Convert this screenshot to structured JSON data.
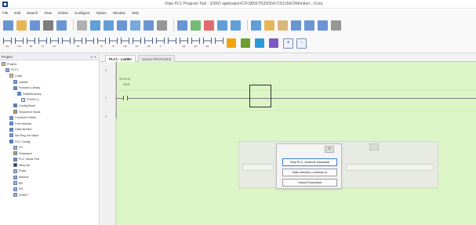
{
  "window": {
    "title": "Xinje PLC Program Tool - 3/3KD application\\C\\FSB5670\\3\\5\\5\\6\\7\\3\\1\\3\\ED\\Monitor\\...\\Corp"
  },
  "menu": [
    "File",
    "Edit",
    "Search",
    "View",
    "Online",
    "Configure",
    "Option",
    "Window",
    "Help"
  ],
  "toolbar_row1": {
    "icons": [
      "new-icon",
      "open-icon",
      "save-icon",
      "cut-icon",
      "copy-icon",
      "paste-icon",
      "undo-icon",
      "redo-icon",
      "find-icon",
      "block-icon",
      "list-icon",
      "print-icon",
      "settings-icon",
      "run-icon",
      "stop-icon",
      "monitor-icon",
      "upload-icon",
      "download-icon",
      "folder-icon",
      "user-icon",
      "image-icon",
      "chart-icon",
      "table-icon",
      "minus-icon"
    ]
  },
  "toolbar_row2": {
    "items": [
      {
        "icon": "contact-no-icon",
        "caption": "Tes"
      },
      {
        "icon": "contact-nc-icon",
        "caption": "rUet"
      },
      {
        "icon": "coil-icon",
        "caption": "tM"
      },
      {
        "icon": "edge-icon",
        "caption": "M"
      },
      {
        "icon": "parallel-icon",
        "caption": "DT"
      },
      {
        "icon": "branch-icon",
        "caption": ""
      },
      {
        "icon": "vline-icon",
        "caption": "fM"
      },
      {
        "icon": "hline-icon",
        "caption": ""
      },
      {
        "icon": "pulse-up-icon",
        "caption": "f4"
      },
      {
        "icon": "pulse-down-icon",
        "caption": "f5"
      },
      {
        "icon": "instr-icon",
        "caption": "sf6"
      },
      {
        "icon": "set-icon",
        "caption": "sf7"
      },
      {
        "icon": "reset-icon",
        "caption": "sf8"
      },
      {
        "icon": "out-icon",
        "caption": "fi"
      },
      {
        "icon": "inv-icon",
        "caption": ""
      },
      {
        "icon": "mps-icon",
        "caption": "af1"
      },
      {
        "icon": "mrd-icon",
        "caption": "af3"
      },
      {
        "icon": "mpp-icon",
        "caption": "af4"
      },
      {
        "icon": "func-icon",
        "caption": ""
      }
    ],
    "color_buttons": [
      "#f2a30f",
      "#6e9e2f",
      "#2b9bd8",
      "#7e57c2"
    ],
    "zoom_in_label": "+",
    "zoom_out_label": "-"
  },
  "project_panel": {
    "title": "Project",
    "controls": "⨯ ✕",
    "tree": [
      {
        "label": "Project",
        "depth": 0,
        "icon": "folder-icon"
      },
      {
        "label": "PLC1",
        "depth": 1,
        "icon": "plc-icon"
      },
      {
        "label": "Code",
        "depth": 2,
        "icon": "folder-icon"
      },
      {
        "label": "Ladder",
        "depth": 3,
        "icon": "ladder-icon"
      },
      {
        "label": "Function Library",
        "depth": 3,
        "icon": "library-icon"
      },
      {
        "label": "DefaultLibrary",
        "depth": 4,
        "icon": "library-icon"
      },
      {
        "label": "FUNC2.c",
        "depth": 5,
        "icon": "file-icon"
      },
      {
        "label": "Config Block",
        "depth": 3,
        "icon": "config-icon"
      },
      {
        "label": "Sequence Block",
        "depth": 3,
        "icon": "sequence-icon"
      },
      {
        "label": "Comment Editor",
        "depth": 2,
        "icon": "comment-icon"
      },
      {
        "label": "Free Monitor",
        "depth": 2,
        "icon": "monitor-icon"
      },
      {
        "label": "Data Monitor",
        "depth": 2,
        "icon": "data-icon"
      },
      {
        "label": "Set Reg Init Value",
        "depth": 2,
        "icon": "register-icon"
      },
      {
        "label": "PLC Config",
        "depth": 2,
        "icon": "config-icon"
      },
      {
        "label": "I/O",
        "depth": 3,
        "icon": "io-icon"
      },
      {
        "label": "Password",
        "depth": 3,
        "icon": "lock-icon"
      },
      {
        "label": "PLC Serial Port",
        "depth": 3,
        "icon": "port-icon"
      },
      {
        "label": "ethernet",
        "depth": 3,
        "icon": "ethernet-icon"
      },
      {
        "label": "Pulse",
        "depth": 3,
        "icon": "pulse-icon"
      },
      {
        "label": "Module",
        "depth": 3,
        "icon": "module-icon"
      },
      {
        "label": "BD",
        "depth": 3,
        "icon": "bd-icon"
      },
      {
        "label": "ED",
        "depth": 3,
        "icon": "ed-icon"
      },
      {
        "label": "eSNET",
        "depth": 3,
        "icon": "network-icon"
      }
    ]
  },
  "tabs": [
    {
      "label": "PLC1 - Ladder",
      "active": true
    },
    {
      "label": "Source:File\\FUNC2",
      "active": false
    }
  ],
  "ladder": {
    "rung_numbers": [
      "0",
      "1",
      "2"
    ],
    "comment_top": "0H+D+00",
    "comment_mid": "M100"
  },
  "dialog": {
    "close_label": "✕",
    "buttons": [
      {
        "label": "Stop PLC, continue download"
      },
      {
        "label": "Date retention, continue to"
      },
      {
        "label": "Cancel Download"
      }
    ]
  }
}
